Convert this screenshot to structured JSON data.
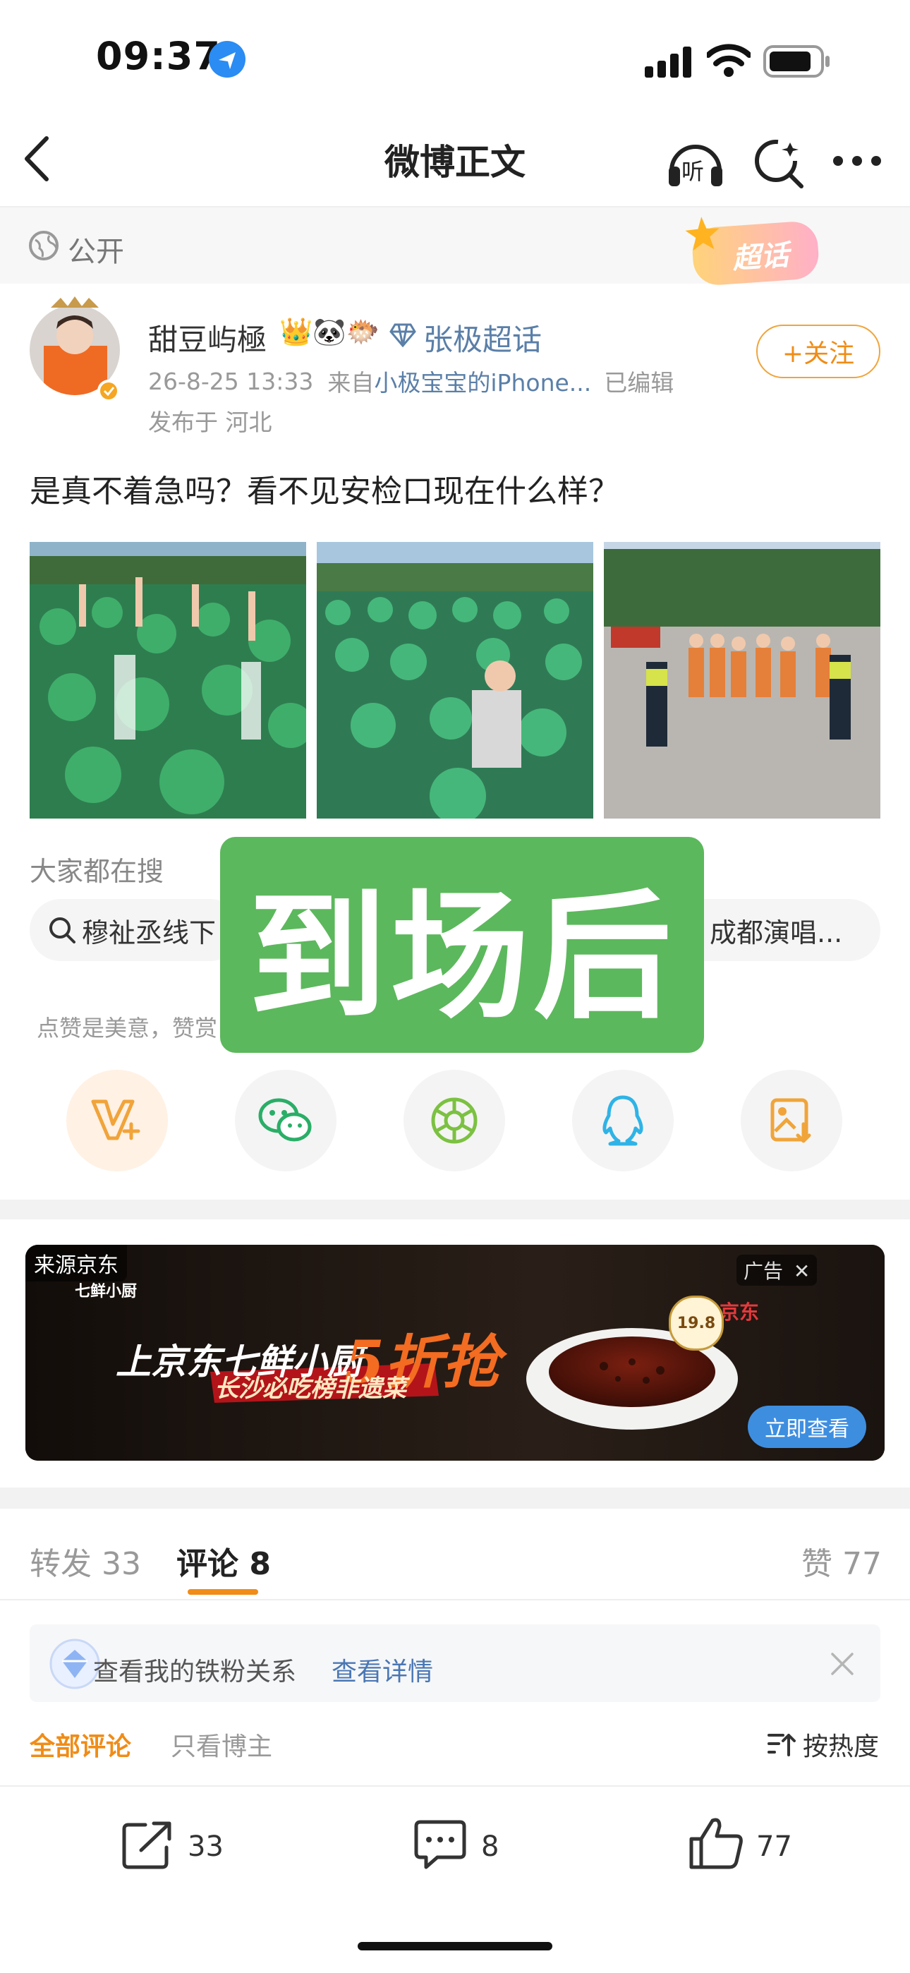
{
  "status_bar": {
    "time": "09:37",
    "icons": [
      "location-arrow-icon",
      "cellular-signal-icon",
      "wifi-icon",
      "battery-icon"
    ]
  },
  "nav": {
    "title": "微博正文",
    "listen_label": "听",
    "icons": [
      "back-icon",
      "listen-icon",
      "refresh-search-icon",
      "more-icon"
    ]
  },
  "visibility": {
    "label": "公开",
    "supertopic_badge": "超话"
  },
  "post": {
    "username": "甜豆屿極",
    "emoji_badges": "👑🐼🐡",
    "supertopic_link": "张极超话",
    "time": "26-8-25 13:33",
    "source_prefix": "来自",
    "source_device": "小极宝宝的iPhone...",
    "edited": "已编辑",
    "location": "发布于 河北",
    "follow_label": "+关注",
    "text": "是真不着急吗？看不见安检口现在什么样？",
    "photos": [
      "crowd in green caps raising hands",
      "dense crowd in green caps waiting",
      "security staff and crowd in orange at plaza"
    ]
  },
  "overlay_stamp": {
    "text": "到场后",
    "color": "#5cb85c"
  },
  "search": {
    "title": "大家都在搜",
    "chips": [
      "穆祉丞线下",
      "成都演唱..."
    ]
  },
  "like_hint": "点赞是美意，赞赏",
  "share_targets": [
    "weibo-v-plus-icon",
    "wechat-icon",
    "moments-icon",
    "qq-icon",
    "save-image-icon"
  ],
  "ad": {
    "source": "来源京东",
    "tag": "广告",
    "brand": "七鲜小厨",
    "headline": "上京东七鲜小厨",
    "promo": "5折抢",
    "subline": "长沙必吃榜非遗菜",
    "price_badge": "19.8",
    "jd_label": "京东",
    "cta": "立即查看"
  },
  "tabs": {
    "repost": "转发 33",
    "comment": "评论 8",
    "like": "赞 77"
  },
  "fan_bar": {
    "text": "查看我的铁粉关系",
    "link": "查看详情"
  },
  "comment_filters": {
    "all": "全部评论",
    "author_only": "只看博主",
    "sort": "按热度"
  },
  "bottom_actions": {
    "repost": "33",
    "comment": "8",
    "like": "77"
  },
  "colors": {
    "accent_orange": "#f08c17",
    "link_blue": "#5a7fa8",
    "stamp_green": "#5cb85c"
  }
}
